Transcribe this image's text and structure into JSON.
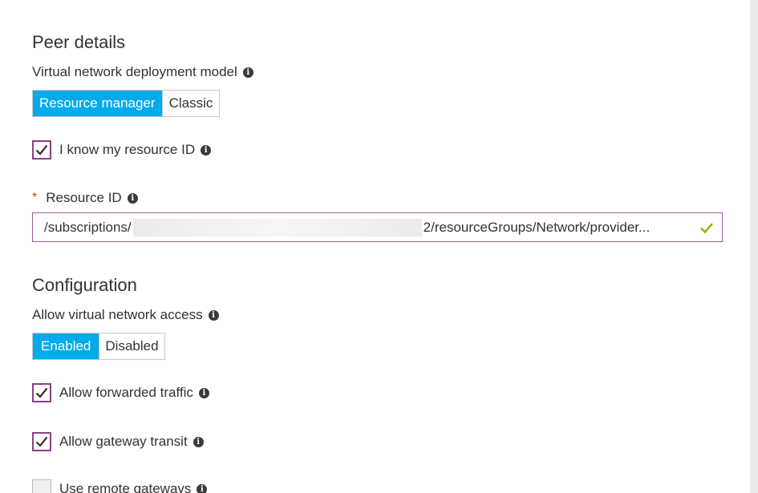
{
  "peer_details": {
    "heading": "Peer details",
    "deployment_model_label": "Virtual network deployment model",
    "deployment_model_options": [
      "Resource manager",
      "Classic"
    ],
    "deployment_model_selected": "Resource manager",
    "know_resource_id_label": "I know my resource ID",
    "know_resource_id_checked": true,
    "resource_id_required_marker": "*",
    "resource_id_label": "Resource ID",
    "resource_id_value_prefix": "/subscriptions/",
    "resource_id_value_suffix": "2/resourceGroups/Network/provider...",
    "resource_id_valid": true
  },
  "configuration": {
    "heading": "Configuration",
    "vnet_access_label": "Allow virtual network access",
    "vnet_access_options": [
      "Enabled",
      "Disabled"
    ],
    "vnet_access_selected": "Enabled",
    "allow_forwarded_traffic_label": "Allow forwarded traffic",
    "allow_forwarded_traffic_checked": true,
    "allow_gateway_transit_label": "Allow gateway transit",
    "allow_gateway_transit_checked": true,
    "use_remote_gateways_label": "Use remote gateways",
    "use_remote_gateways_checked": false
  },
  "icons": {
    "info": "info-icon",
    "check": "check-icon",
    "valid": "valid-check-icon"
  },
  "colors": {
    "selected_toggle": "#00abec",
    "checkbox_border": "#8d3e8b",
    "field_border": "#a05ca0",
    "valid_check": "#7fba00",
    "required_star": "#d83b01"
  }
}
